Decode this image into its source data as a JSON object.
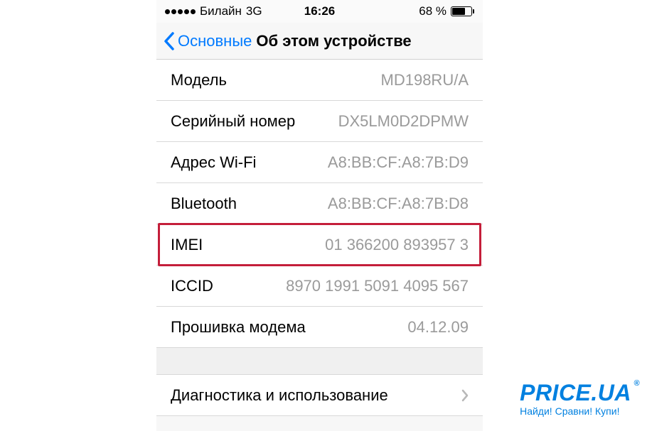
{
  "status_bar": {
    "carrier": "Билайн",
    "network": "3G",
    "time": "16:26",
    "battery_percent": "68 %"
  },
  "nav": {
    "back_label": "Основные",
    "title": "Об этом устройстве"
  },
  "rows": [
    {
      "label": "Модель",
      "value": "MD198RU/A"
    },
    {
      "label": "Серийный номер",
      "value": "DX5LM0D2DPMW"
    },
    {
      "label": "Адрес Wi-Fi",
      "value": "A8:BB:CF:A8:7B:D9"
    },
    {
      "label": "Bluetooth",
      "value": "A8:BB:CF:A8:7B:D8"
    },
    {
      "label": "IMEI",
      "value": "01 366200 893957 3"
    },
    {
      "label": "ICCID",
      "value": "8970 1991 5091 4095 567"
    },
    {
      "label": "Прошивка модема",
      "value": "04.12.09"
    }
  ],
  "disclosure": {
    "label": "Диагностика и использование"
  },
  "watermark": {
    "title": "PRICE.UA",
    "reg": "®",
    "tagline": "Найди! Сравни! Купи!"
  },
  "highlighted_row_index": 4
}
